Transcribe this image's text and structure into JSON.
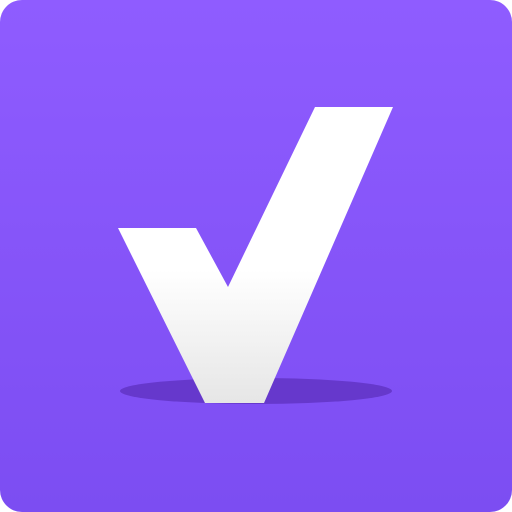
{
  "icon": {
    "name": "checkmark-app-icon",
    "glyph": "checkmark-icon",
    "colors": {
      "background_top": "#8F5CFF",
      "background_bottom": "#7C4DF2",
      "glyph_top": "#FFFFFF",
      "glyph_bottom": "#E6E6E6",
      "shadow": "#6638CC"
    }
  }
}
